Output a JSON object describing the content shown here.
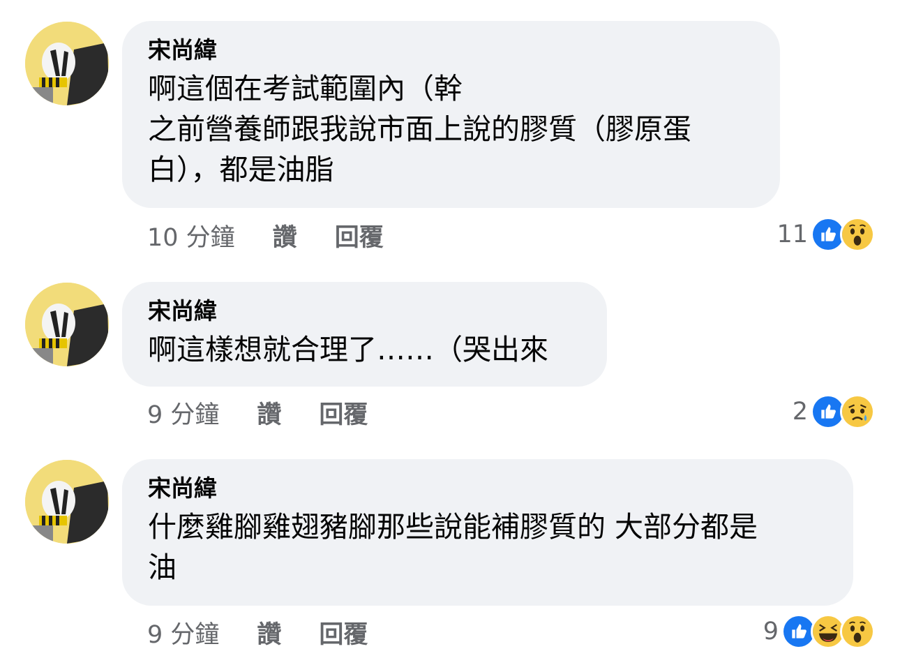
{
  "comments": [
    {
      "author": "宋尚緯",
      "lines": [
        "啊這個在考試範圍內（幹",
        "之前營養師跟我說市面上說的膠質（膠原蛋",
        "白），都是油脂"
      ],
      "time": "10 分鐘",
      "like_label": "讚",
      "reply_label": "回覆",
      "reaction_count": "11",
      "reactions": [
        "like-icon",
        "wow-icon"
      ]
    },
    {
      "author": "宋尚緯",
      "lines": [
        "啊這樣想就合理了……（哭出來"
      ],
      "time": "9 分鐘",
      "like_label": "讚",
      "reply_label": "回覆",
      "reaction_count": "2",
      "reactions": [
        "like-icon",
        "sad-icon"
      ]
    },
    {
      "author": "宋尚緯",
      "lines": [
        "什麼雞腳雞翅豬腳那些說能補膠質的 大部分都是",
        "油"
      ],
      "time": "9 分鐘",
      "like_label": "讚",
      "reply_label": "回覆",
      "reaction_count": "9",
      "reactions": [
        "like-icon",
        "haha-icon",
        "wow-icon"
      ]
    }
  ],
  "colors": {
    "bubble": "#f0f2f5",
    "meta_text": "#65676b",
    "like_blue": "#1877f2",
    "emoji_yellow": "#f7c843"
  }
}
